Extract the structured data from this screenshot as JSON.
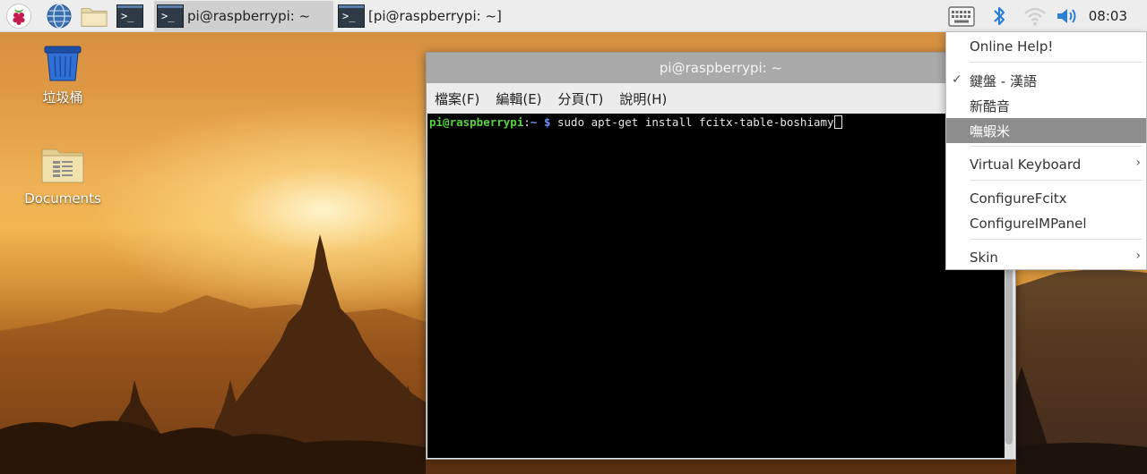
{
  "taskbar": {
    "launchers": [
      {
        "icon": "raspberry-menu-icon"
      },
      {
        "icon": "web-browser-icon"
      },
      {
        "icon": "file-manager-icon"
      },
      {
        "icon": "terminal-icon"
      }
    ],
    "tasks": [
      {
        "title": "pi@raspberrypi: ~",
        "active": true
      },
      {
        "title": "[pi@raspberrypi: ~]",
        "active": false
      }
    ],
    "tray": {
      "icons": [
        "keyboard-icon",
        "bluetooth-icon",
        "wifi-icon",
        "volume-icon"
      ],
      "clock": "08:03"
    }
  },
  "desktop": {
    "icons": [
      {
        "label": "垃圾桶",
        "icon": "trash-icon"
      },
      {
        "label": "Documents",
        "icon": "folder-icon"
      }
    ]
  },
  "terminal": {
    "title": "pi@raspberrypi: ~",
    "menu": [
      "檔案(F)",
      "編輯(E)",
      "分頁(T)",
      "說明(H)"
    ],
    "prompt_user": "pi@raspberrypi",
    "prompt_sep": ":",
    "prompt_path": "~ $",
    "command": " sudo apt-get install fcitx-table-boshiamy"
  },
  "im_menu": {
    "items": [
      {
        "label": "Online Help!",
        "checked": false,
        "submenu": false,
        "highlighted": false
      },
      {
        "label": "鍵盤 - 漢語",
        "checked": true,
        "submenu": false,
        "highlighted": false
      },
      {
        "label": "新酷音",
        "checked": false,
        "submenu": false,
        "highlighted": false
      },
      {
        "label": "嘸蝦米",
        "checked": false,
        "submenu": false,
        "highlighted": true
      },
      {
        "label": "Virtual Keyboard",
        "checked": false,
        "submenu": true,
        "highlighted": false
      },
      {
        "label": "ConfigureFcitx",
        "checked": false,
        "submenu": false,
        "highlighted": false
      },
      {
        "label": "ConfigureIMPanel",
        "checked": false,
        "submenu": false,
        "highlighted": false
      },
      {
        "label": "Skin",
        "checked": false,
        "submenu": true,
        "highlighted": false
      }
    ],
    "check_glyph": "✓",
    "arrow_glyph": "›"
  },
  "colors": {
    "taskbar_bg": "#ededed",
    "menu_highlight": "#8c8c8c",
    "prompt_user": "#55d43f",
    "prompt_path": "#6e8eff"
  }
}
